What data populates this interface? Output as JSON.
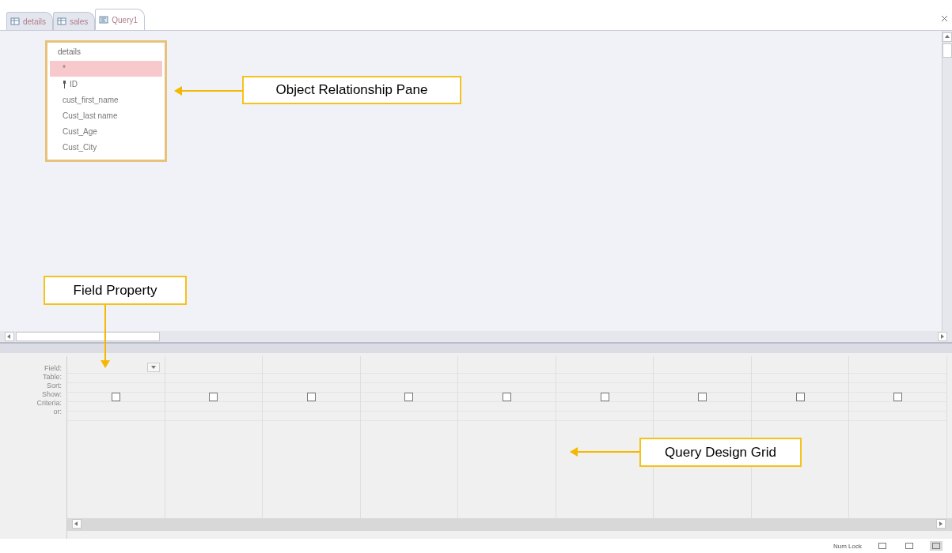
{
  "tabs": [
    {
      "label": "details",
      "kind": "table",
      "selected": false
    },
    {
      "label": "sales",
      "kind": "table",
      "selected": false
    },
    {
      "label": "Query1",
      "kind": "query",
      "selected": true
    }
  ],
  "table_box": {
    "title": "details",
    "fields": [
      {
        "name": "*",
        "selected": true,
        "key": false
      },
      {
        "name": "ID",
        "selected": false,
        "key": true
      },
      {
        "name": "cust_first_name",
        "selected": false,
        "key": false
      },
      {
        "name": "Cust_last name",
        "selected": false,
        "key": false
      },
      {
        "name": "Cust_Age",
        "selected": false,
        "key": false
      },
      {
        "name": "Cust_City",
        "selected": false,
        "key": false
      }
    ]
  },
  "grid": {
    "row_labels": [
      "Field:",
      "Table:",
      "Sort:",
      "Show:",
      "Criteria:",
      "or:"
    ],
    "columns": [
      {
        "show_checked": false
      },
      {
        "show_checked": false
      },
      {
        "show_checked": false
      },
      {
        "show_checked": false
      },
      {
        "show_checked": false
      },
      {
        "show_checked": false
      },
      {
        "show_checked": false
      },
      {
        "show_checked": false
      },
      {
        "show_checked": false
      }
    ]
  },
  "status_bar": {
    "text": "Num Lock",
    "views": [
      {
        "selected": false
      },
      {
        "selected": false
      },
      {
        "selected": true
      }
    ]
  },
  "annotations": [
    {
      "label": "Object Relationship Pane"
    },
    {
      "label": "Field Property"
    },
    {
      "label": "Query Design Grid"
    }
  ]
}
